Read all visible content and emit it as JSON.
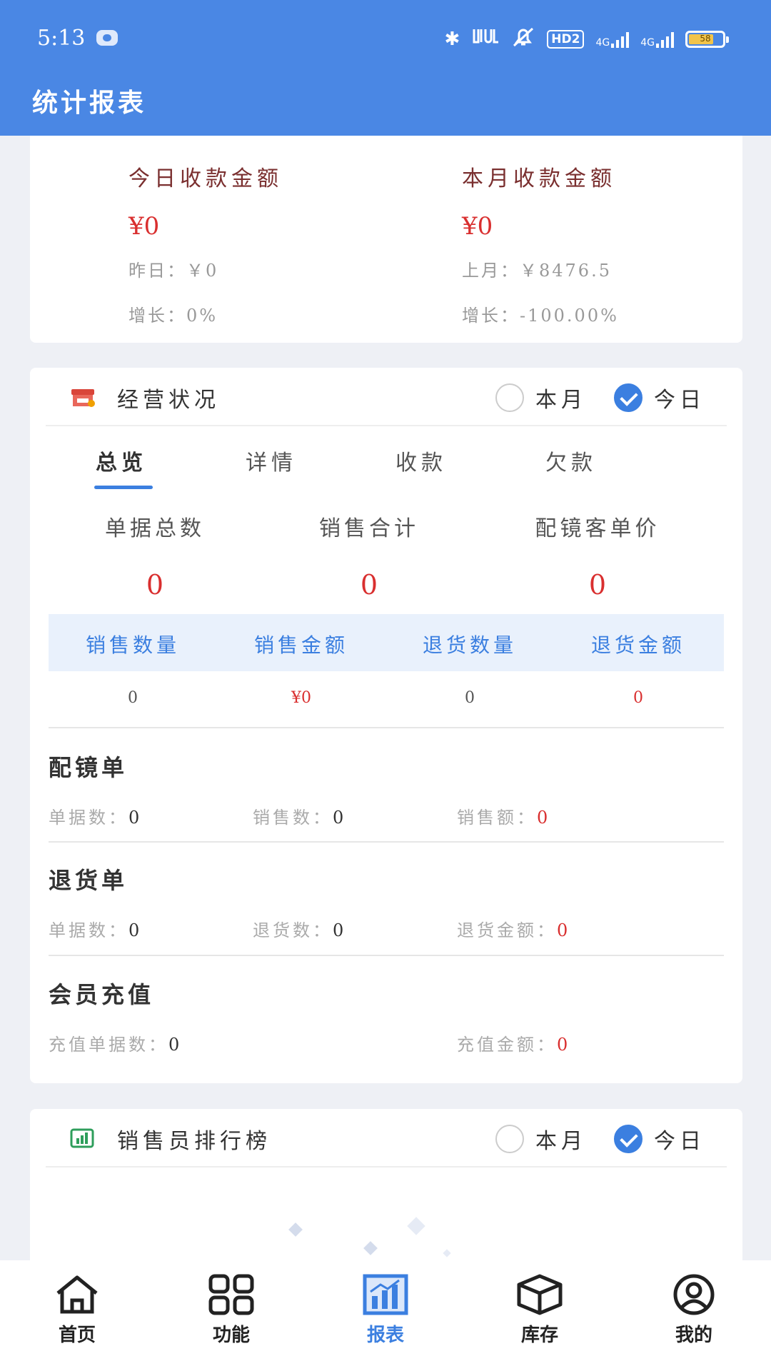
{
  "status_bar": {
    "time": "5:13",
    "bluetooth": "✱",
    "network_label": "HD2",
    "net_type_1": "4G",
    "net_type_2": "4G",
    "battery": "58"
  },
  "header": {
    "title": "统计报表"
  },
  "summary": {
    "today": {
      "title": "今日收款金额",
      "amount": "¥0",
      "prev": "昨日：￥0",
      "growth": "增长：0%"
    },
    "month": {
      "title": "本月收款金额",
      "amount": "¥0",
      "prev": "上月：￥8476.5",
      "growth": "增长：-100.00%"
    }
  },
  "business": {
    "title": "经营状况",
    "radio_month": "本月",
    "radio_today": "今日",
    "tabs": [
      "总览",
      "详情",
      "收款",
      "欠款"
    ],
    "kpis": [
      {
        "label": "单据总数",
        "value": "0"
      },
      {
        "label": "销售合计",
        "value": "0"
      },
      {
        "label": "配镜客单价",
        "value": "0"
      }
    ],
    "table": {
      "headers": [
        "销售数量",
        "销售金额",
        "退货数量",
        "退货金额"
      ],
      "values": [
        "0",
        "¥0",
        "0",
        "0"
      ]
    },
    "glasses": {
      "title": "配镜单",
      "doc_label": "单据数：",
      "doc_value": "0",
      "sales_label": "销售数：",
      "sales_value": "0",
      "amount_label": "销售额：",
      "amount_value": "0"
    },
    "returns": {
      "title": "退货单",
      "doc_label": "单据数：",
      "doc_value": "0",
      "qty_label": "退货数：",
      "qty_value": "0",
      "amount_label": "退货金额：",
      "amount_value": "0"
    },
    "recharge": {
      "title": "会员充值",
      "doc_label": "充值单据数：",
      "doc_value": "0",
      "amount_label": "充值金额：",
      "amount_value": "0"
    }
  },
  "ranking": {
    "title": "销售员排行榜",
    "radio_month": "本月",
    "radio_today": "今日"
  },
  "bottom_nav": {
    "home": "首页",
    "functions": "功能",
    "reports": "报表",
    "inventory": "库存",
    "mine": "我的"
  },
  "colors": {
    "primary": "#4a87e4",
    "accent_red": "#d92f2f",
    "title_brown": "#7a2f2f"
  }
}
